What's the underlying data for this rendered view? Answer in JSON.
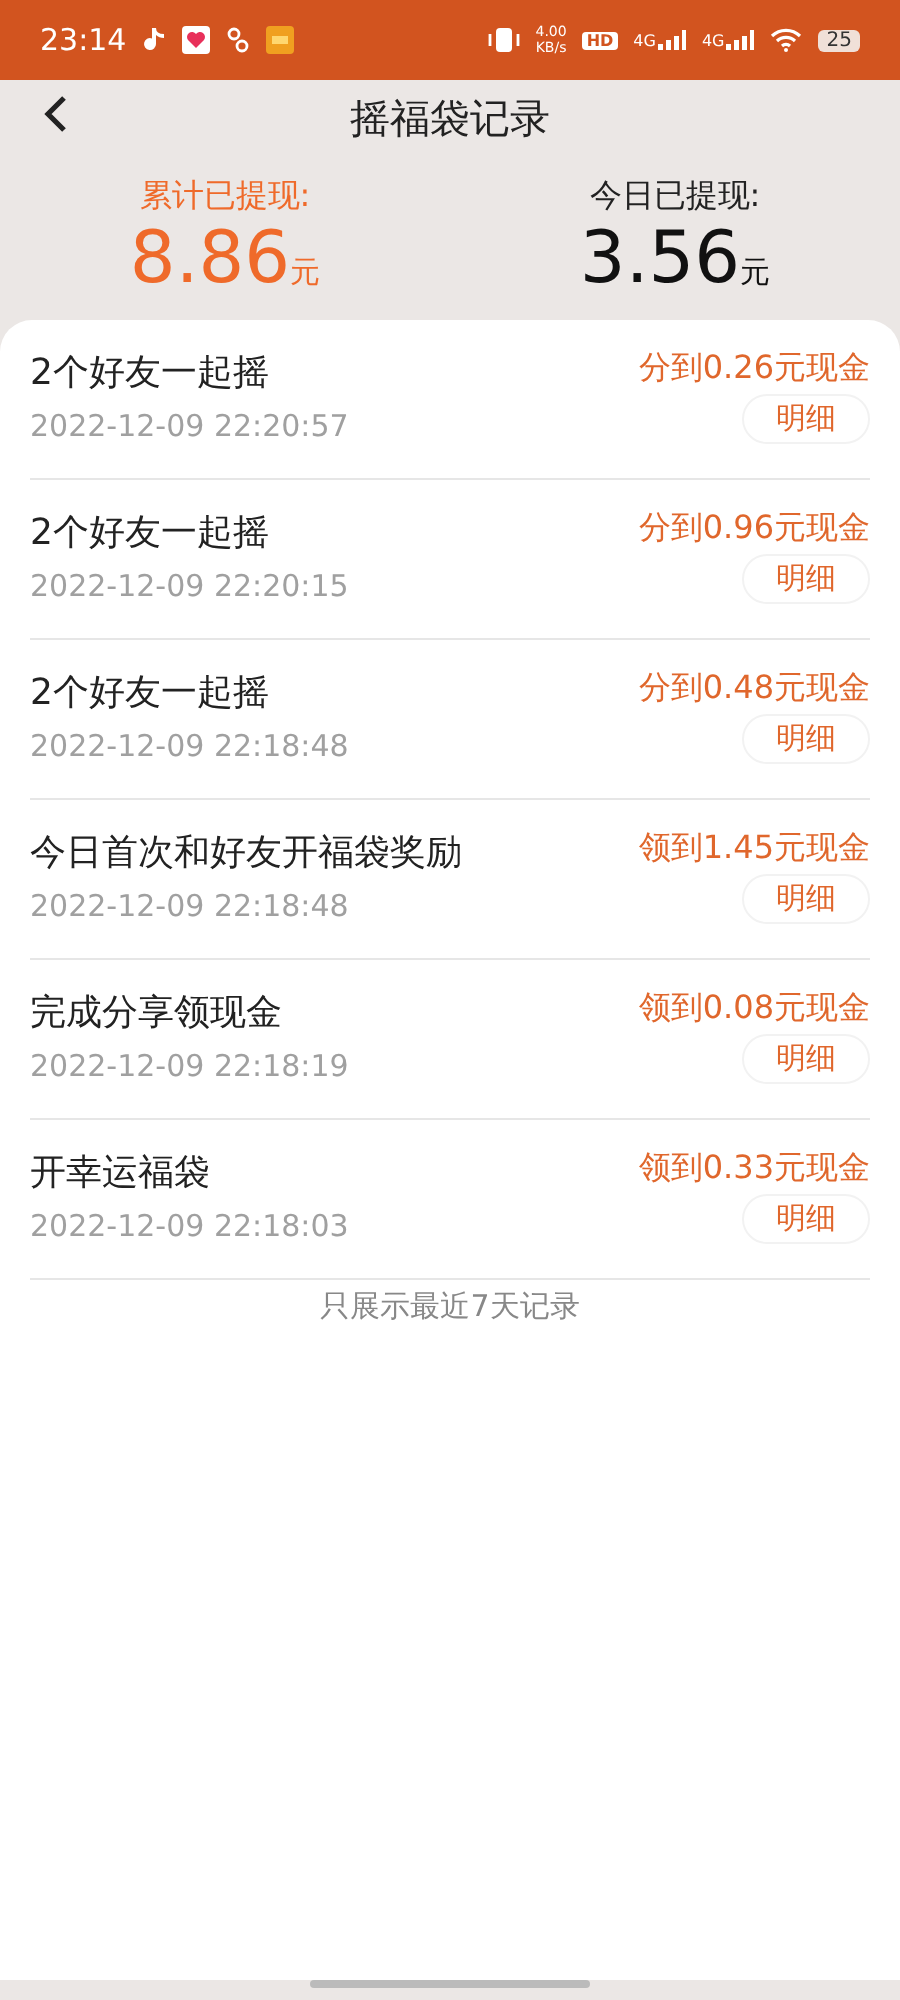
{
  "status_bar": {
    "time": "23:14",
    "net_speed": "4.00",
    "net_unit": "KB/s",
    "hd": "HD",
    "signals": [
      "4G",
      "4G"
    ],
    "battery": "25"
  },
  "title": "摇福袋记录",
  "summary": [
    {
      "label": "累计已提现:",
      "amount": "8.86",
      "unit": "元",
      "highlight": true
    },
    {
      "label": "今日已提现:",
      "amount": "3.56",
      "unit": "元",
      "highlight": false
    }
  ],
  "records": [
    {
      "title": "2个好友一起摇",
      "time": "2022-12-09 22:20:57",
      "reward": "分到0.26元现金",
      "button": "明细"
    },
    {
      "title": "2个好友一起摇",
      "time": "2022-12-09 22:20:15",
      "reward": "分到0.96元现金",
      "button": "明细"
    },
    {
      "title": "2个好友一起摇",
      "time": "2022-12-09 22:18:48",
      "reward": "分到0.48元现金",
      "button": "明细"
    },
    {
      "title": "今日首次和好友开福袋奖励",
      "time": "2022-12-09 22:18:48",
      "reward": "领到1.45元现金",
      "button": "明细"
    },
    {
      "title": "完成分享领现金",
      "time": "2022-12-09 22:18:19",
      "reward": "领到0.08元现金",
      "button": "明细"
    },
    {
      "title": "开幸运福袋",
      "time": "2022-12-09 22:18:03",
      "reward": "领到0.33元现金",
      "button": "明细"
    }
  ],
  "footer_note": "只展示最近7天记录"
}
